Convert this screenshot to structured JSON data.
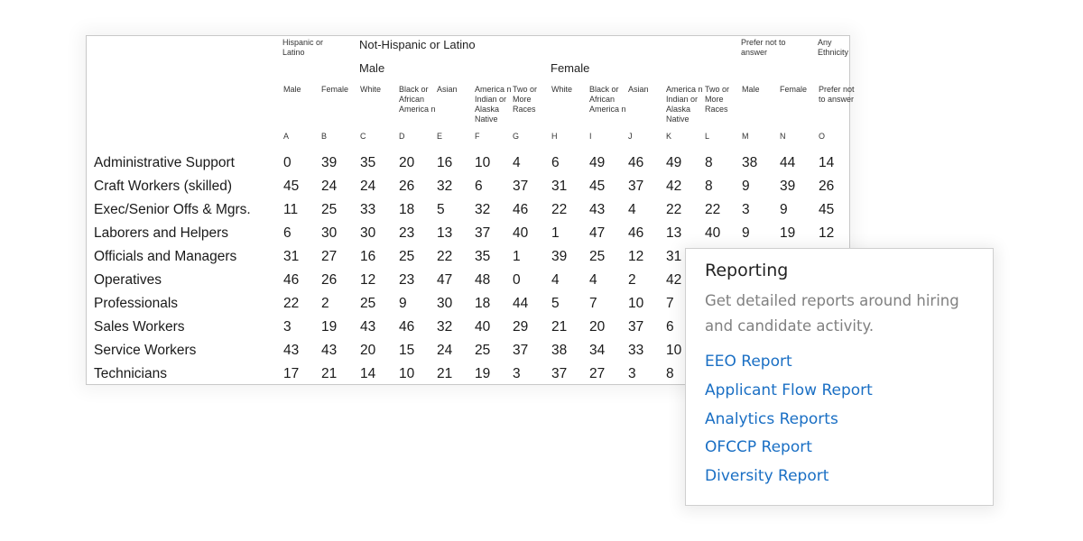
{
  "table": {
    "group_headers": {
      "hispanic": "Hispanic or Latino",
      "not_hispanic": "Not-Hispanic or Latino",
      "male": "Male",
      "female": "Female",
      "prefer_not": "Prefer not to answer",
      "any_ethnicity": "Any Ethnicity"
    },
    "columns": [
      {
        "label": "Male",
        "letter": "A"
      },
      {
        "label": "Female",
        "letter": "B"
      },
      {
        "label": "White",
        "letter": "C"
      },
      {
        "label": "Black or African America n",
        "letter": "D"
      },
      {
        "label": "Asian",
        "letter": "E"
      },
      {
        "label": "America n Indian or Alaska Native",
        "letter": "F"
      },
      {
        "label": "Two or More Races",
        "letter": "G"
      },
      {
        "label": "White",
        "letter": "H"
      },
      {
        "label": "Black or African America n",
        "letter": "I"
      },
      {
        "label": "Asian",
        "letter": "J"
      },
      {
        "label": "America n Indian or Alaska Native",
        "letter": "K"
      },
      {
        "label": "Two or More Races",
        "letter": "L"
      },
      {
        "label": "Male",
        "letter": "M"
      },
      {
        "label": "Female",
        "letter": "N"
      },
      {
        "label": "Prefer not to answer",
        "letter": "O"
      }
    ],
    "rows": [
      {
        "label": "Administrative Support",
        "values": [
          "0",
          "39",
          "35",
          "20",
          "16",
          "10",
          "4",
          "6",
          "49",
          "46",
          "49",
          "8",
          "38",
          "44",
          "14"
        ]
      },
      {
        "label": "Craft Workers (skilled)",
        "values": [
          "45",
          "24",
          "24",
          "26",
          "32",
          "6",
          "37",
          "31",
          "45",
          "37",
          "42",
          "8",
          "9",
          "39",
          "26"
        ]
      },
      {
        "label": "Exec/Senior Offs & Mgrs.",
        "values": [
          "11",
          "25",
          "33",
          "18",
          "5",
          "32",
          "46",
          "22",
          "43",
          "4",
          "22",
          "22",
          "3",
          "9",
          "45"
        ]
      },
      {
        "label": "Laborers and Helpers",
        "values": [
          "6",
          "30",
          "30",
          "23",
          "13",
          "37",
          "40",
          "1",
          "47",
          "46",
          "13",
          "40",
          "9",
          "19",
          "12"
        ]
      },
      {
        "label": "Officials and Managers",
        "values": [
          "31",
          "27",
          "16",
          "25",
          "22",
          "35",
          "1",
          "39",
          "25",
          "12",
          "31"
        ]
      },
      {
        "label": "Operatives",
        "values": [
          "46",
          "26",
          "12",
          "23",
          "47",
          "48",
          "0",
          "4",
          "4",
          "2",
          "42"
        ]
      },
      {
        "label": "Professionals",
        "values": [
          "22",
          "2",
          "25",
          "9",
          "30",
          "18",
          "44",
          "5",
          "7",
          "10",
          "7"
        ]
      },
      {
        "label": "Sales Workers",
        "values": [
          "3",
          "19",
          "43",
          "46",
          "32",
          "40",
          "29",
          "21",
          "20",
          "37",
          "6"
        ]
      },
      {
        "label": "Service Workers",
        "values": [
          "43",
          "43",
          "20",
          "15",
          "24",
          "25",
          "37",
          "38",
          "34",
          "33",
          "10"
        ]
      },
      {
        "label": "Technicians",
        "values": [
          "17",
          "21",
          "14",
          "10",
          "21",
          "19",
          "3",
          "37",
          "27",
          "3",
          "8"
        ]
      }
    ]
  },
  "popup": {
    "title": "Reporting",
    "description": "Get detailed reports around hiring and candidate activity.",
    "links": [
      "EEO Report",
      "Applicant Flow Report",
      "Analytics Reports",
      "OFCCP Report",
      "Diversity Report"
    ],
    "link_color": "#1a6fc4"
  }
}
